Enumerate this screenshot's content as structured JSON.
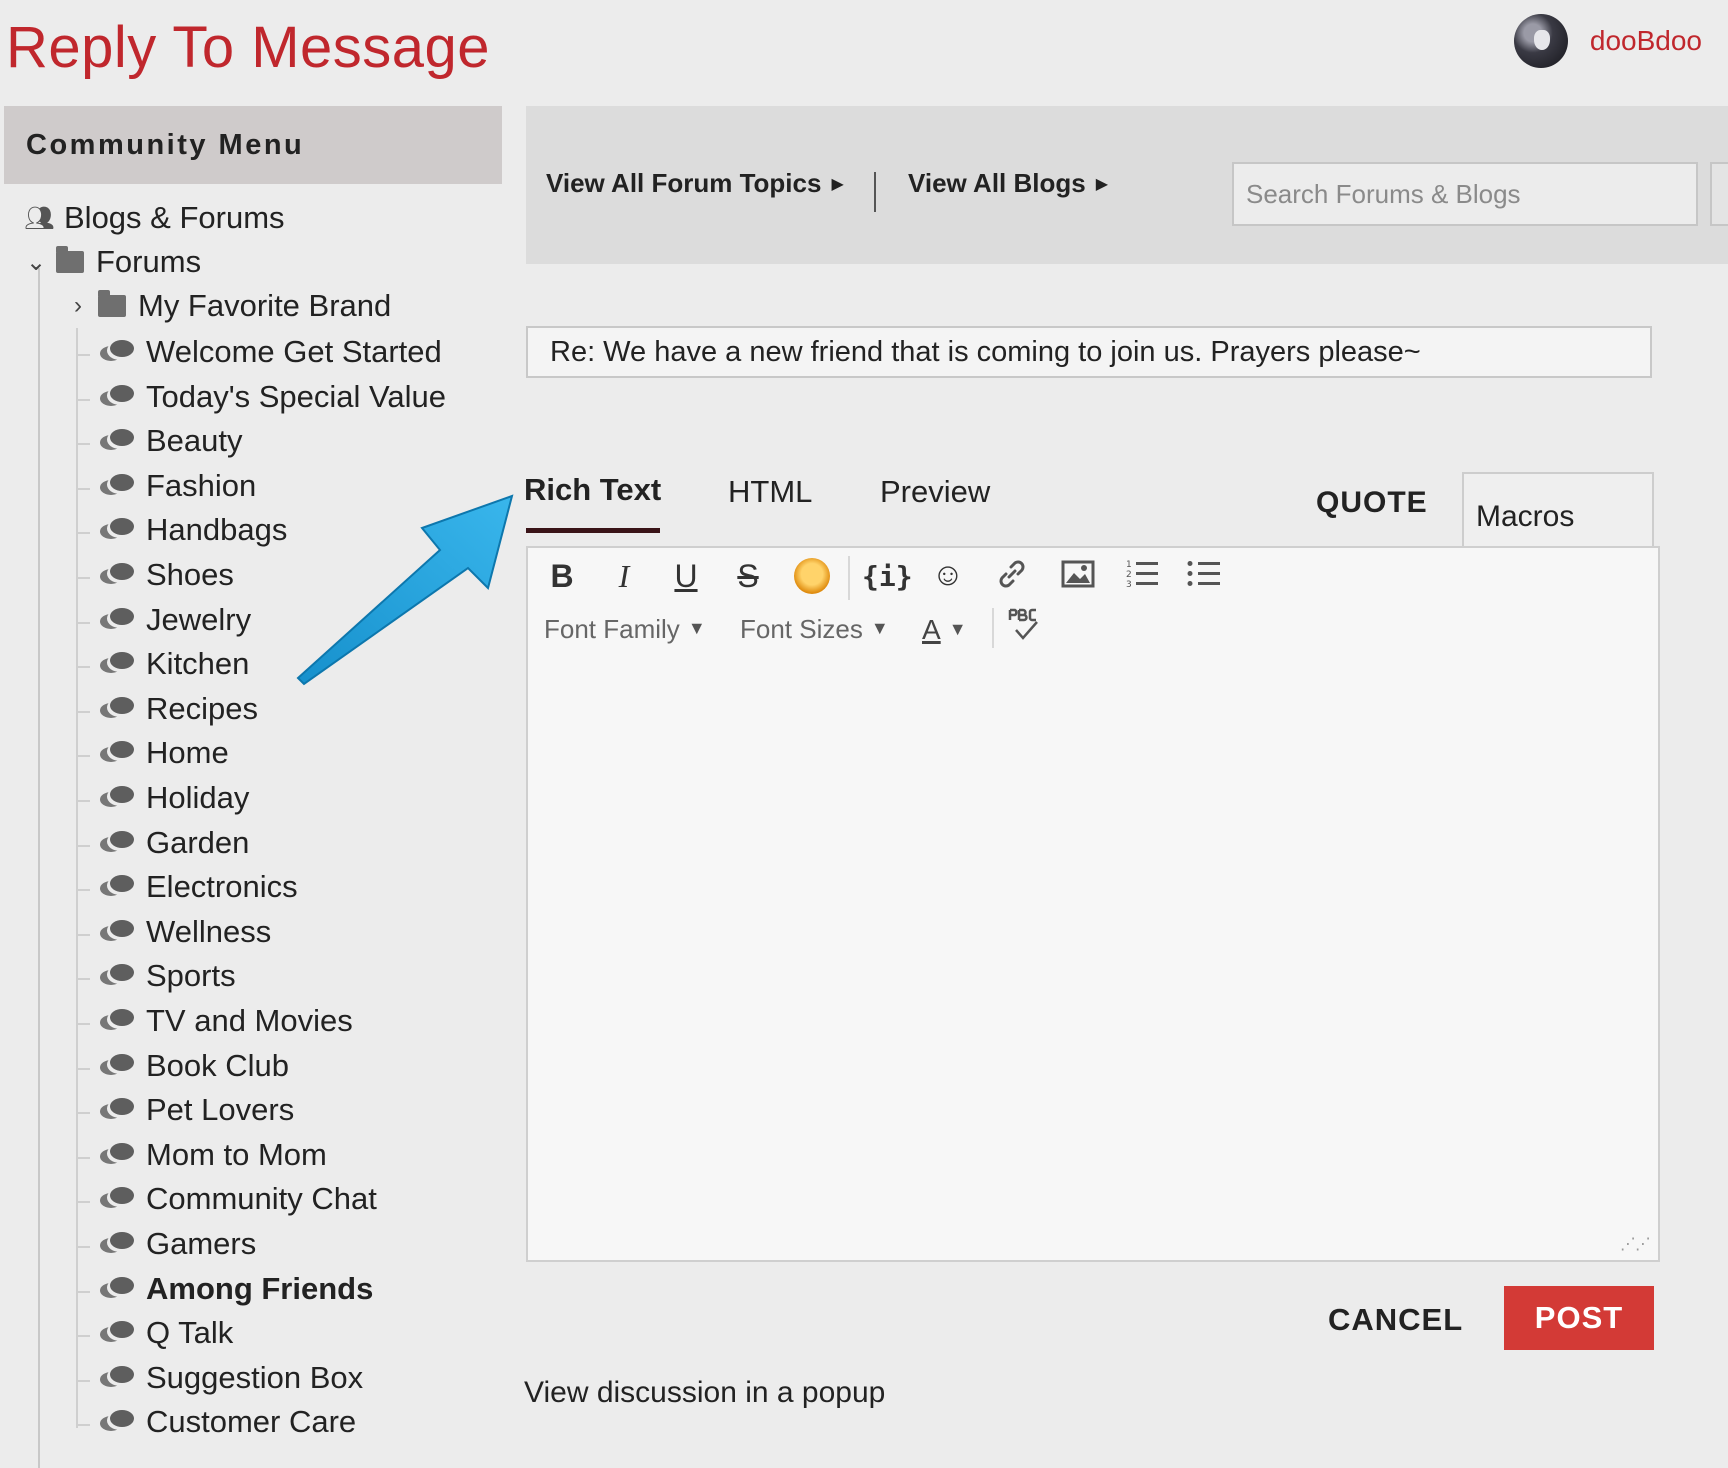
{
  "header": {
    "title": "Reply To Message",
    "username": "dooBdoo"
  },
  "sidebar": {
    "menu_title": "Community Menu",
    "root": "Blogs & Forums",
    "forums": "Forums",
    "favorite": "My Favorite Brand",
    "items": [
      "Welcome Get Started",
      "Today's Special Value",
      "Beauty",
      "Fashion",
      "Handbags",
      "Shoes",
      "Jewelry",
      "Kitchen",
      "Recipes",
      "Home",
      "Holiday",
      "Garden",
      "Electronics",
      "Wellness",
      "Sports",
      "TV and Movies",
      "Book Club",
      "Pet Lovers",
      "Mom to Mom",
      "Community Chat",
      "Gamers",
      "Among Friends",
      "Q Talk",
      "Suggestion Box",
      "Customer Care"
    ]
  },
  "nav": {
    "forum_topics": "View All Forum Topics",
    "blogs": "View All Blogs",
    "search_placeholder": "Search Forums & Blogs"
  },
  "compose": {
    "subject": "Re: We have a new friend that is coming to join us. Prayers please~",
    "tabs": [
      "Rich Text",
      "HTML",
      "Preview"
    ],
    "quote": "QUOTE",
    "macros": "Macros",
    "font_family": "Font Family",
    "font_sizes": "Font Sizes",
    "cancel": "CANCEL",
    "post": "POST",
    "popup": "View discussion in a popup"
  },
  "colors": {
    "brand_red": "#c0272d",
    "post_button": "#d33a36",
    "arrow_blue": "#1ea0dc"
  }
}
